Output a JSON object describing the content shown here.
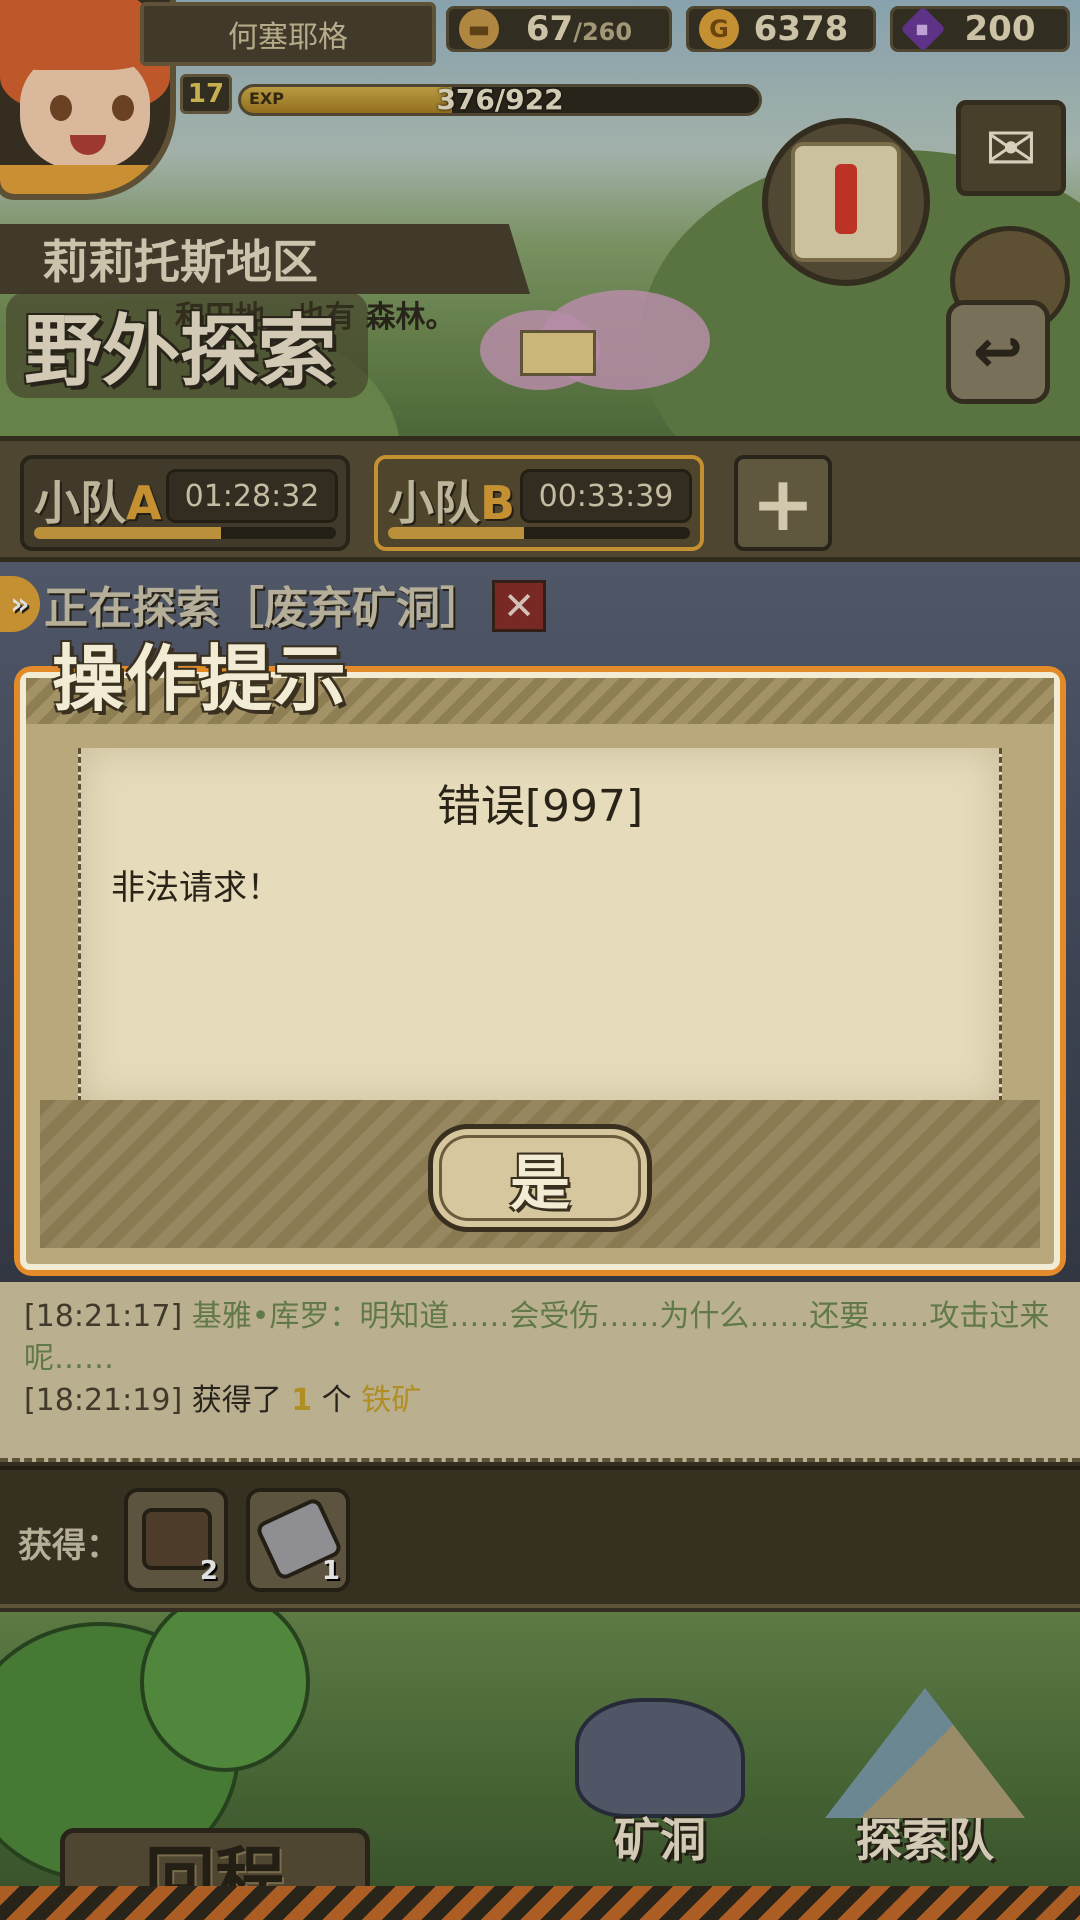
{
  "player": {
    "name": "何塞耶格",
    "level": "17",
    "exp_tag": "EXP",
    "exp_text": "376/922",
    "exp_fraction": 0.408
  },
  "resources": {
    "stamina_value": "67",
    "stamina_max": "/260",
    "gold": "6378",
    "gold_icon_letter": "G",
    "gems": "200"
  },
  "region": {
    "name": "莉莉托斯地区",
    "description": "和田地，也有 森林。",
    "mode_title": "野外探索"
  },
  "teams": [
    {
      "label_prefix": "小队",
      "letter": "A",
      "timer": "01:28:32",
      "progress": 0.62
    },
    {
      "label_prefix": "小队",
      "letter": "B",
      "timer": "00:33:39",
      "progress": 0.45
    }
  ],
  "add_team_symbol": "+",
  "explore_status": "正在探索［废弃矿洞］",
  "cancel_symbol": "✕",
  "log": [
    {
      "time": "[18:21:17]",
      "speaker": "基雅•库罗",
      "text": "：明知道……会受伤……为什么……还要……攻击过来呢……"
    },
    {
      "time": "[18:21:19]",
      "prefix": "获得了 ",
      "count": "1",
      "mid": " 个 ",
      "item": "铁矿"
    }
  ],
  "loot": {
    "label": "获得：",
    "items": [
      {
        "icon": "treasure-chest-icon",
        "count": "2"
      },
      {
        "icon": "iron-ore-icon",
        "count": "1"
      }
    ]
  },
  "nav": {
    "return_label": "回程",
    "mine_label": "矿洞",
    "team_label": "探索队"
  },
  "dialog": {
    "title": "操作提示",
    "heading": "错误[997]",
    "message": "非法请求！",
    "confirm_label": "是"
  },
  "colors": {
    "accent_orange": "#e38a2a",
    "dialog_paper": "#e6dcbc",
    "frame_dark": "#2f2a1e",
    "log_item_gold": "#c8a22a",
    "log_npc_green": "#6f8a52"
  }
}
